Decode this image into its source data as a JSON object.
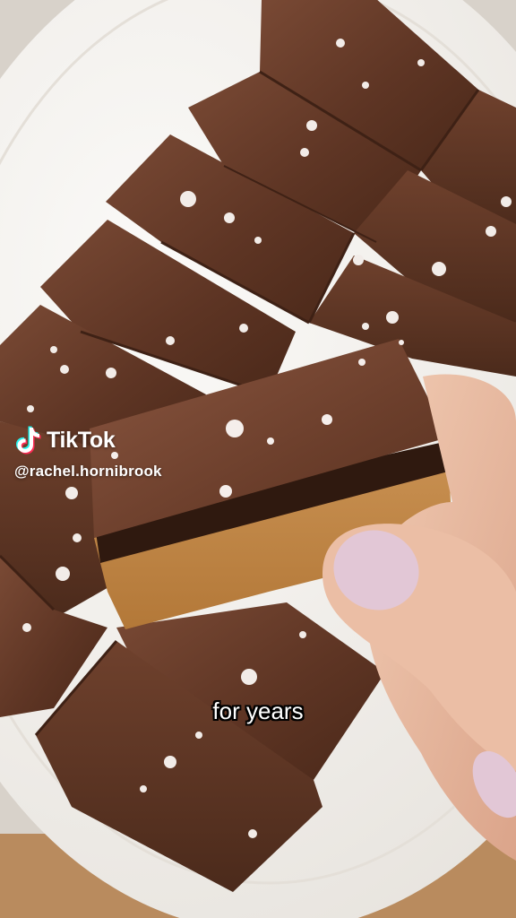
{
  "video": {
    "description_icon": "video-frame"
  },
  "watermark": {
    "brand": "TikTok",
    "handle": "@rachel.hornibrook",
    "logo_icon": "tiktok-note-icon",
    "logo_colors": {
      "cyan": "#25F4EE",
      "pink": "#FE2C55",
      "white": "#FFFFFF"
    }
  },
  "caption": {
    "text": "for years"
  },
  "colors": {
    "chocolate": "#5b3322",
    "chocolate_highlight": "#7a4a35",
    "plate": "#f3f1ee",
    "base_layer": "#c68b4e",
    "nail_polish": "#e2c7d6",
    "skin": "#e7b9a0"
  }
}
